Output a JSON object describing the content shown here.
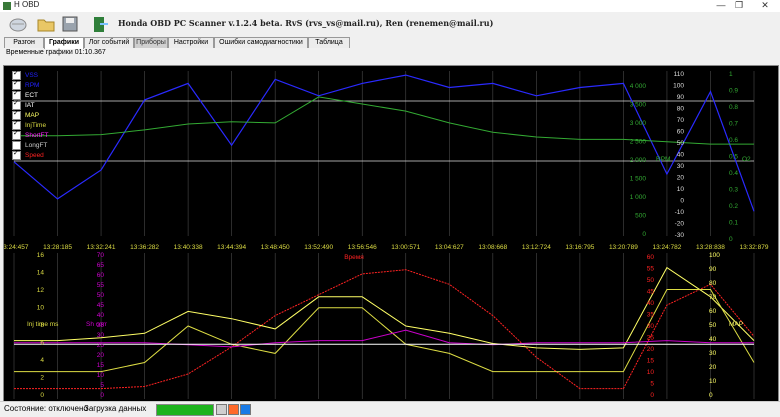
{
  "window": {
    "title": "H OBD",
    "min": "—",
    "max": "❐",
    "close": "✕"
  },
  "app": {
    "title": "Honda OBD PC Scanner v.1.2.4 beta. RvS (rvs_vs@mail.ru), Ren (renemen@mail.ru)"
  },
  "toolbar": {
    "icons": [
      "connect-icon",
      "open-icon",
      "save-icon",
      "exit-icon"
    ]
  },
  "tabs": [
    {
      "label": "Разгон"
    },
    {
      "label": "Графики"
    },
    {
      "label": "Лог событий"
    },
    {
      "label": "Приборы"
    },
    {
      "label": "Настройки"
    },
    {
      "label": "Ошибки самодиагностики"
    },
    {
      "label": "Таблица"
    }
  ],
  "graph": {
    "title": "Временные графики  01:10.367"
  },
  "legend": [
    {
      "label": "VSS",
      "checked": true,
      "color": "#2222ff"
    },
    {
      "label": "RPM",
      "checked": true,
      "color": "#2222ff"
    },
    {
      "label": "ECT",
      "checked": true,
      "color": "#ffffff"
    },
    {
      "label": "IAT",
      "checked": true,
      "color": "#ffffff"
    },
    {
      "label": "MAP",
      "checked": true,
      "color": "#ffff66"
    },
    {
      "label": "InjTime",
      "checked": true,
      "color": "#dddd44"
    },
    {
      "label": "ShortFT",
      "checked": true,
      "color": "#cc00cc"
    },
    {
      "label": "LongFT",
      "checked": false,
      "color": "#cccccc"
    },
    {
      "label": "Speed",
      "checked": true,
      "color": "#ff2222"
    }
  ],
  "time_axis": [
    "13:24:457",
    "13:28:185",
    "13:32:241",
    "13:36:282",
    "13:40:338",
    "13:44:394",
    "13:48:450",
    "13:52:490",
    "13:56:546",
    "13:00:571",
    "13:04:627",
    "13:08:668",
    "13:12:724",
    "13:16:795",
    "13:20:789",
    "13:24:782",
    "13:28:838",
    "13:32:879"
  ],
  "top_axes": {
    "rpm": {
      "label": "RPM",
      "ticks": [
        "4 000",
        "3 500",
        "3 000",
        "2 500",
        "2 000",
        "1 500",
        "1 000",
        "500",
        "0"
      ]
    },
    "ect": {
      "ticks": [
        "110",
        "100",
        "90",
        "80",
        "70",
        "60",
        "50",
        "40",
        "30",
        "20",
        "10",
        "0",
        "-10",
        "-20",
        "-30"
      ]
    },
    "o2": {
      "label": "O2",
      "ticks": [
        "1",
        "0.9",
        "0.8",
        "0.7",
        "0.6",
        "0.5",
        "0.4",
        "0.3",
        "0.2",
        "0.1",
        "0"
      ]
    }
  },
  "bottom_axes": {
    "injtime": {
      "label": "Inj time ms",
      "ticks": [
        "16",
        "14",
        "12",
        "10",
        "8",
        "6",
        "4",
        "2",
        "0"
      ]
    },
    "shortft": {
      "label": "Sh corr",
      "ticks": [
        "70",
        "65",
        "60",
        "55",
        "50",
        "45",
        "40",
        "35",
        "30",
        "25",
        "20",
        "15",
        "10",
        "5",
        "0"
      ]
    },
    "vss": {
      "label": "Время",
      "ticks": [
        "60",
        "55",
        "50",
        "45",
        "40",
        "35",
        "30",
        "25",
        "20",
        "15",
        "10",
        "5",
        "0"
      ]
    },
    "map": {
      "label": "MAP",
      "ticks": [
        "100",
        "90",
        "80",
        "70",
        "60",
        "50",
        "40",
        "30",
        "20",
        "10",
        "0"
      ]
    }
  },
  "status": {
    "state": "Состояние: отключено",
    "loading": "Загрузка данных",
    "progress": 1.0
  },
  "chart_data": {
    "type": "line",
    "x": [
      "13:24:457",
      "13:28:185",
      "13:32:241",
      "13:36:282",
      "13:40:338",
      "13:44:394",
      "13:48:450",
      "13:52:490",
      "13:56:546",
      "13:00:571",
      "13:04:627",
      "13:08:668",
      "13:12:724",
      "13:16:795",
      "13:20:789",
      "13:24:782",
      "13:28:838",
      "13:32:879"
    ],
    "series_top": [
      {
        "name": "RPM",
        "color": "#2a2aff",
        "values": [
          1800,
          900,
          1600,
          3300,
          3700,
          2200,
          3800,
          3400,
          3700,
          3900,
          3600,
          3700,
          3400,
          3600,
          3700,
          1500,
          3500,
          600
        ]
      },
      {
        "name": "ECT",
        "color": "#33aa33",
        "values": [
          55,
          55,
          56,
          60,
          65,
          67,
          66,
          88,
          82,
          76,
          66,
          58,
          54,
          52,
          52,
          50,
          48,
          48
        ]
      }
    ],
    "series_bottom": [
      {
        "name": "Speed",
        "color": "#ff2222",
        "values": [
          5,
          5,
          5,
          6,
          12,
          25,
          40,
          50,
          60,
          62,
          55,
          40,
          20,
          5,
          5,
          45,
          55,
          30
        ]
      },
      {
        "name": "MAP",
        "color": "#ffff66",
        "values": [
          40,
          40,
          42,
          45,
          60,
          55,
          48,
          70,
          70,
          50,
          45,
          38,
          35,
          34,
          35,
          90,
          70,
          40
        ]
      },
      {
        "name": "InjTime",
        "color": "#dddd44",
        "values": [
          3,
          3,
          3,
          4,
          8,
          6,
          5,
          10,
          10,
          6,
          5,
          3,
          3,
          3,
          3,
          12,
          12,
          4
        ]
      },
      {
        "name": "ShortFT",
        "color": "#cc00cc",
        "values": [
          27,
          27,
          27,
          27,
          26,
          25,
          27,
          28,
          28,
          33,
          27,
          26,
          27,
          27,
          27,
          28,
          27,
          27
        ]
      },
      {
        "name": "IAT",
        "color": "#ffffff",
        "values": [
          6,
          6,
          6,
          6,
          6,
          6,
          6,
          6,
          6,
          6,
          6,
          6,
          6,
          6,
          6,
          6,
          6,
          6
        ]
      }
    ]
  }
}
